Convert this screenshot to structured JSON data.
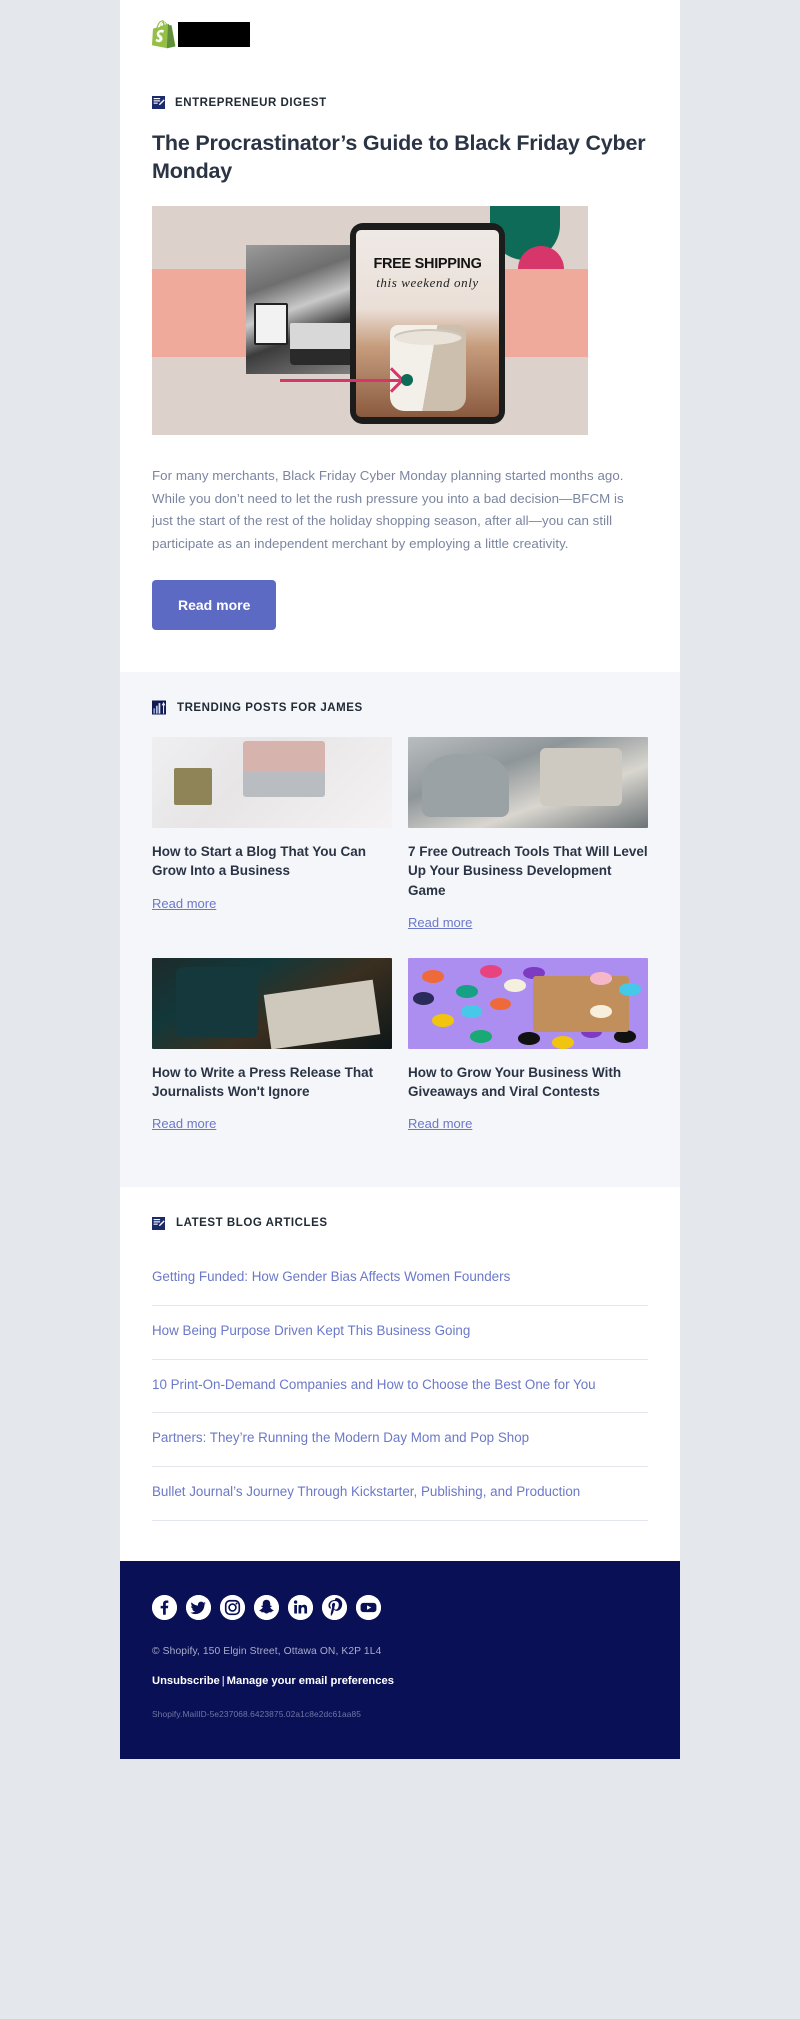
{
  "brand": {
    "logo_name": "shopify-logo",
    "logo_redacted": true,
    "accent_purple": "#5c6ac4",
    "link_purple": "#6b78c9",
    "footer_navy": "#0a1055",
    "heading_color": "#2b3445"
  },
  "article": {
    "eyebrow": "ENTREPRENEUR DIGEST",
    "eyebrow_icon": "newsletter-icon",
    "headline": "The Procrastinator’s Guide to Black Friday Cyber Monday",
    "hero": {
      "free_shipping": "FREE SHIPPING",
      "this_weekend": "this weekend only"
    },
    "body": "For many merchants, Black Friday Cyber Monday planning started months ago. While you don’t need to let the rush pressure you into a bad decision—BFCM is just the start of the rest of the holiday shopping season, after all—you can still participate as an independent merchant by employing a little creativity.",
    "cta_label": "Read more"
  },
  "trending": {
    "heading": "TRENDING POSTS FOR JAMES",
    "heading_icon": "trending-chart-icon",
    "read_more_label": "Read more",
    "posts": [
      {
        "title": "How to Start a Blog That You Can Grow Into a Business",
        "link_label": "Read more",
        "image": "laptop-flatlay-photo"
      },
      {
        "title": "7 Free Outreach Tools That Will Level Up Your Business Development Game",
        "link_label": "Read more",
        "image": "team-meeting-photo"
      },
      {
        "title": "How to Write a Press Release That Journalists Won't Ignore",
        "link_label": "Read more",
        "image": "man-reading-newspaper-photo"
      },
      {
        "title": "How to Grow Your Business With Giveaways and Viral Contests",
        "link_label": "Read more",
        "image": "gift-confetti-photo"
      }
    ]
  },
  "latest": {
    "heading": "LATEST BLOG ARTICLES",
    "heading_icon": "newsletter-icon",
    "articles": [
      "Getting Funded: How Gender Bias Affects Women Founders",
      "How Being Purpose Driven Kept This Business Going",
      "10 Print-On-Demand Companies and How to Choose the Best One for You",
      "Partners: They’re Running the Modern Day Mom and Pop Shop",
      "Bullet Journal’s Journey Through Kickstarter, Publishing, and Production"
    ]
  },
  "footer": {
    "socials": [
      "facebook-icon",
      "twitter-icon",
      "instagram-icon",
      "snapchat-icon",
      "linkedin-icon",
      "pinterest-icon",
      "youtube-icon"
    ],
    "address": "© Shopify,  150 Elgin Street, Ottawa ON, K2P 1L4",
    "unsubscribe_label": "Unsubscribe",
    "separator": "|",
    "preferences_label": "Manage your email preferences",
    "mail_id": "Shopify.MailID-5e237068.6423875.02a1c8e2dc61aa85"
  }
}
